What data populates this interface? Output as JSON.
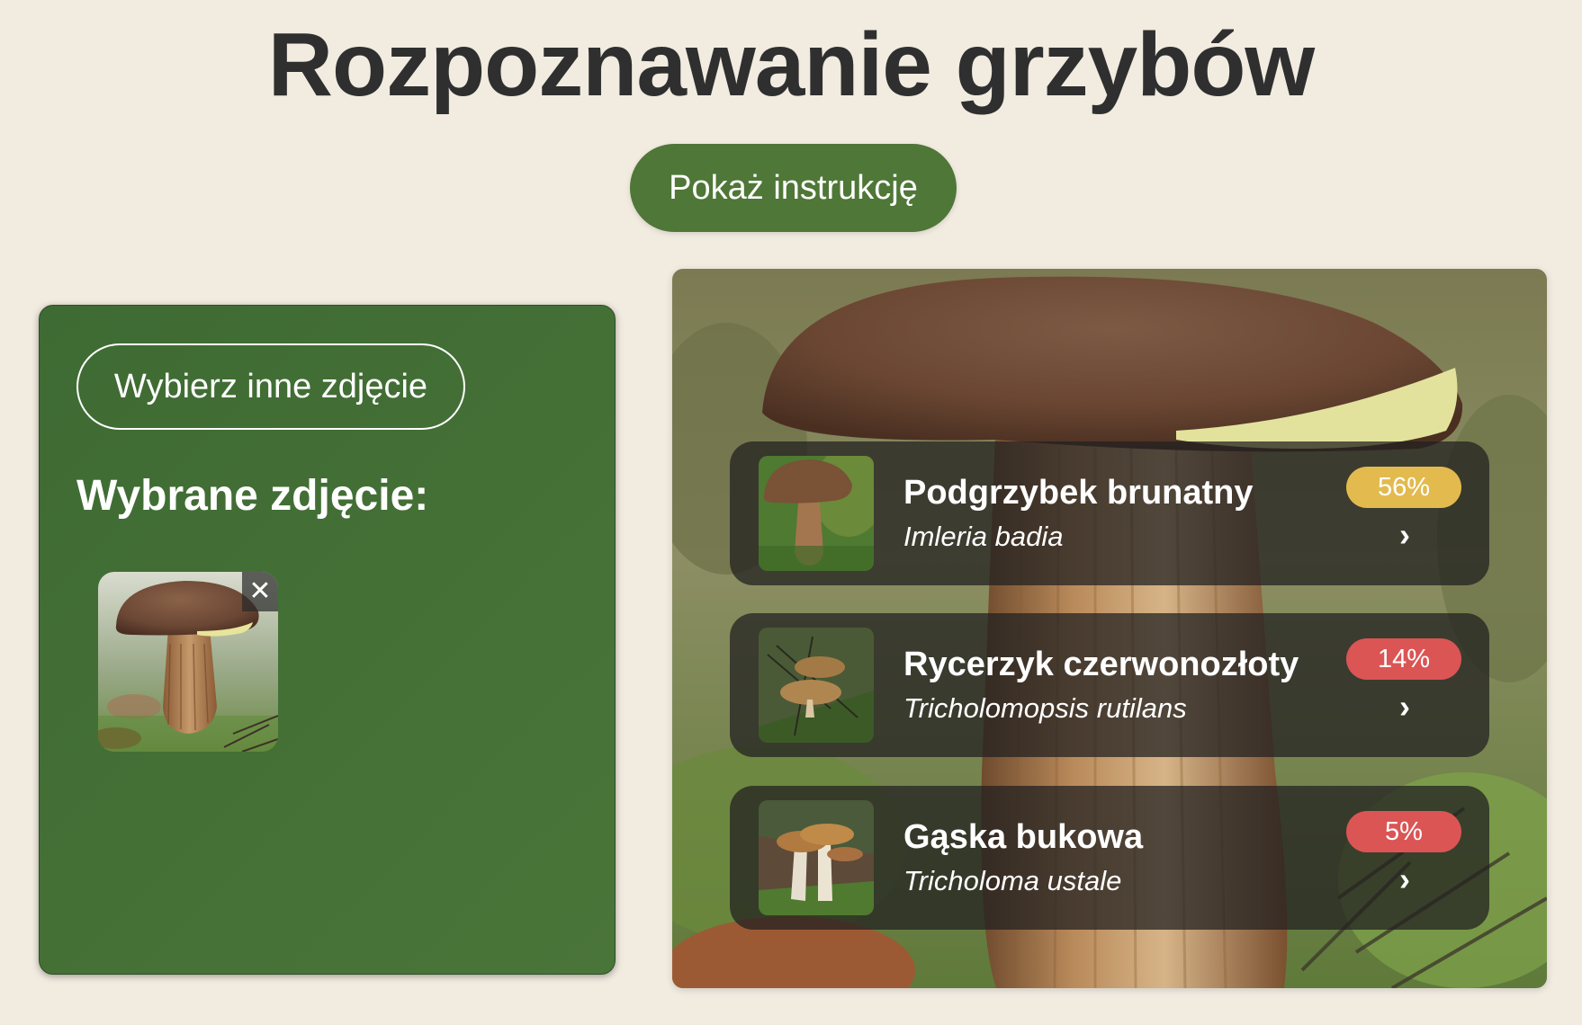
{
  "header": {
    "title": "Rozpoznawanie grzybów",
    "instructions_button": "Pokaż instrukcję"
  },
  "upload_panel": {
    "choose_button": "Wybierz inne zdjęcie",
    "selected_label": "Wybrane zdjęcie:",
    "remove_icon": "close-icon",
    "remove_glyph": "✕"
  },
  "results": [
    {
      "name": "Podgrzybek brunatny",
      "latin": "Imleria badia",
      "confidence": "56%",
      "badge_color": "#e2ba4e",
      "chevron": "›"
    },
    {
      "name": "Rycerzyk czerwonozłoty",
      "latin": "Tricholomopsis rutilans",
      "confidence": "14%",
      "badge_color": "#db5555",
      "chevron": "›"
    },
    {
      "name": "Gąska bukowa",
      "latin": "Tricholoma ustale",
      "confidence": "5%",
      "badge_color": "#db5555",
      "chevron": "›"
    }
  ],
  "colors": {
    "background": "#f1ebe0",
    "accent_green": "#4f7737",
    "panel_green": "#426e35",
    "card_overlay": "#222020",
    "badge_high": "#e2ba4e",
    "badge_low": "#db5555"
  }
}
